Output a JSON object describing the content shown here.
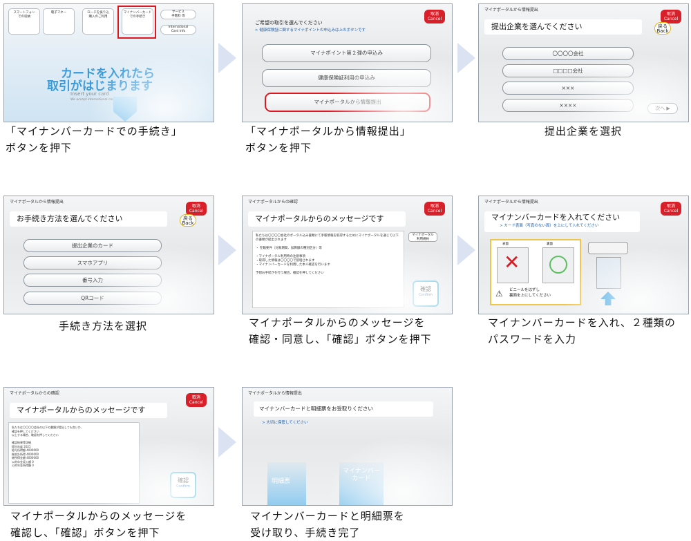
{
  "arrow_color": "#dbe3f3",
  "accent_red": "#e0161e",
  "steps": [
    {
      "caption": "「マイナンバーカードでの手続き」\nボタンを押下",
      "tiles": [
        "スマートフォン\nでの収納",
        "電子マネー",
        "ローチを振り込\n購入のご利用",
        "マイナンバーカード\nでの手続き"
      ],
      "pills": [
        "サービス\n手数料 等",
        "International\nCard Info"
      ],
      "banner_line1": "カードを入れたら",
      "banner_line2": "取引がはじまります",
      "banner_en1": "Insert your card",
      "banner_en2": "We accept international cards"
    },
    {
      "caption": "「マイナポータルから情報提出」\nボタンを押下",
      "cancel": "取消\nCancel",
      "prompt": "ご希望の取引を選んでください",
      "note": "> 健康保険証に関するマイナポイントの申込みは上のボタンです",
      "options": [
        "マイナポイント第２弾の申込み",
        "健康保険証利用の申込み",
        "マイナポータルから情報提出"
      ]
    },
    {
      "caption": "提出企業を選択",
      "header": "マイナポータルから情報提出",
      "cancel": "取消\nCancel",
      "title": "提出企業を選んでください",
      "back": "戻る\nBack",
      "options": [
        "〇〇〇〇会社",
        "□□□□会社",
        "×××",
        "××××"
      ],
      "next": "次へ ▶"
    },
    {
      "caption": "手続き方法を選択",
      "header": "マイナポータルから情報提出",
      "cancel": "取消\nCancel",
      "title": "お手続き方法を選んでください",
      "back": "戻る\nBack",
      "options": [
        "提出企業のカード",
        "スマホアプリ",
        "番号入力",
        "QRコード"
      ]
    },
    {
      "caption": "マイナポータルからのメッセージを\n確認・同意し、「確認」ボタンを押下",
      "header": "マイナポータルからの確認",
      "cancel": "取消\nCancel",
      "title": "マイナポータルからのメッセージです",
      "side": "マイナポータル\n利用規約",
      "message": "私たちは〇〇〇〇会社のポータル込み書類にて手帳情報を取得するためにマイナポータルを通じて以下の書類が提出されます\n\n・ 在籍要件（対象期間、加算額の種別区分）等\n\n・マイナポータル利用時の注意事項\n・取得した情報は〇〇〇〇で管理されます\n・マイナンバーカードを利用した本人確認を行います\n\n予想お手続きを行う場合、確認を押してください",
      "confirm": "確認",
      "confirm_en": "Confirm"
    },
    {
      "caption": "マイナンバーカードを入れ、２種類の\nパスワードを入力",
      "header": "マイナポータルから情報提出",
      "cancel": "取消\nCancel",
      "title": "マイナンバーカードを入れてください",
      "note": "> カード表面（写真のない面）を上にして入れてください",
      "front": "表面",
      "back_side": "裏面",
      "warning": "ビニールをはずし\n裏面を上にしてください"
    },
    {
      "caption": "マイナポータルからのメッセージを\n確認し、「確認」ボタンを押下",
      "header": "マイナポータルからの確認",
      "cancel": "取消\nCancel",
      "title": "マイナポータルからのメッセージです",
      "message": "私たちは〇〇〇〇会社の以下の書類が提出しても良いか、\n確認を押してください\n以上する場合、確認を押してください\n\n                              確認結果等詳細\n 提出年度                          2021\n 給与所得額                      4000000\n 総合計所得                      4000000\n 総所得金額                      4000000\n 公的年金収入額                        0\n 公的年金所得額                        0",
      "confirm": "確認",
      "confirm_en": "Confirm"
    },
    {
      "caption": "マイナンバーカードと明細票を\n受け取り、手続き完了",
      "header": "マイナポータルから情報提出",
      "title": "マイナンバーカードと明細票をお受取りください",
      "note": "> 大切に保管してください",
      "slip": "明細票",
      "card": "マイナンバー\nカード"
    }
  ]
}
